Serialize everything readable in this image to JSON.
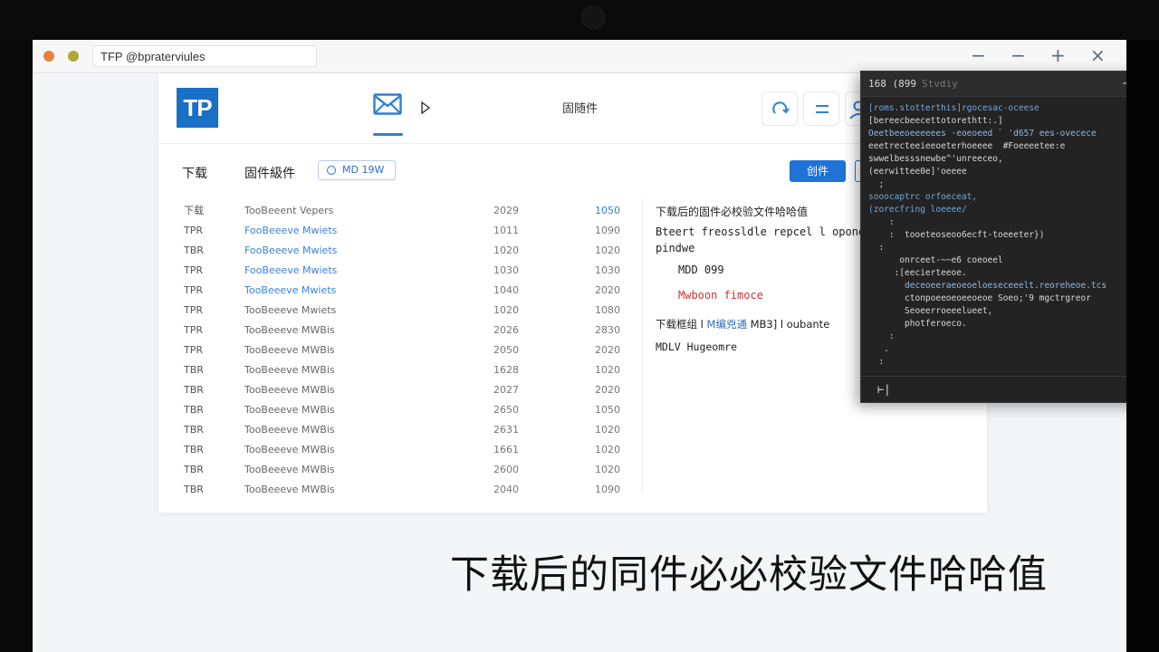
{
  "window": {
    "tab_title": "TFP @bpraterviules",
    "controls": [
      "minimize-icon",
      "minimize-icon",
      "maximize-icon",
      "close-icon"
    ]
  },
  "app": {
    "logo_text": "TP",
    "nav_title": "固随件",
    "toolbar": {
      "tab_download": "下载",
      "tab_firmware": "固件級件",
      "search_value": "MD 19W",
      "primary_button": "创件"
    },
    "table": {
      "rows": [
        {
          "c1": "下载",
          "c2": "TooBeeent Vepers",
          "c3": "2029",
          "c4": "1050"
        },
        {
          "c1": "TPR",
          "c2": "FooBeeeve Mwiets",
          "c3": "1011",
          "c4": "1090"
        },
        {
          "c1": "TBR",
          "c2": "FooBeeeve Mwiets",
          "c3": "1020",
          "c4": "1020"
        },
        {
          "c1": "TPR",
          "c2": "FooBeeeve Mwiets",
          "c3": "1030",
          "c4": "1030"
        },
        {
          "c1": "TPR",
          "c2": "TooBeeeve Mwiets",
          "c3": "1040",
          "c4": "2020"
        },
        {
          "c1": "TPR",
          "c2": "TooBeeeve Mwiets",
          "c3": "1020",
          "c4": "1080"
        },
        {
          "c1": "TPR",
          "c2": "TooBeeeve MWBis",
          "c3": "2026",
          "c4": "2830"
        },
        {
          "c1": "TPR",
          "c2": "TooBeeeve MWBis",
          "c3": "2050",
          "c4": "2020"
        },
        {
          "c1": "TBR",
          "c2": "TooBeeeve MWBis",
          "c3": "1628",
          "c4": "1020"
        },
        {
          "c1": "TBR",
          "c2": "TooBeeeve MWBis",
          "c3": "2027",
          "c4": "2020"
        },
        {
          "c1": "TBR",
          "c2": "TooBeeeve MWBis",
          "c3": "2650",
          "c4": "1050"
        },
        {
          "c1": "TBR",
          "c2": "TooBeeeve MWBis",
          "c3": "2631",
          "c4": "1020"
        },
        {
          "c1": "TBR",
          "c2": "TooBeeeve MWBis",
          "c3": "1661",
          "c4": "1020"
        },
        {
          "c1": "TBR",
          "c2": "TooBeeeve MWBis",
          "c3": "2600",
          "c4": "1020"
        },
        {
          "c1": "TBR",
          "c2": "TooBeeeve MWBis",
          "c3": "2040",
          "c4": "1090"
        }
      ]
    },
    "detail": {
      "title": "下载后的固件必校验文件哈哈值",
      "line1": "Bteert freossldle repcel l opone",
      "line2": "pindwe",
      "mdd": "MDD 099",
      "red_text": "Mwboon fimoce",
      "download_label": "下载框组 l",
      "download_link": "M编兇通",
      "download_mid": "MB3] l",
      "download_tail": "oubante",
      "mdlv": "MDLV Hugeomre"
    }
  },
  "terminal": {
    "title": "168 (899",
    "title_dim": "Stvdiy",
    "lines": [
      "[roms.stotterthis]rgocesac-oceese",
      "[bereecbeecettotorethtt:.]",
      "Oeetbeeoeeeeees ·eoeoeed ` 'd657 ees-ovecece",
      "eeetrecteeieeoeterhoeeee  #Foeeeetee:e",
      "swwelbesssnewbe^'unreeceo,",
      "(eerwittee0e]'oeeee",
      "  ;",
      "sooocaptrc orfoeceat,",
      "(zorecfring loeeee/",
      "    :",
      "    :  tooeteoseoo6ecft-toeeeter})",
      "  :",
      "      onrceet-~~e6 coeoeel",
      "     :[eecierteeoe.",
      "       deceoeeraeoeoeloeseceeelt.reoreheoe.tcs",
      "       ctonpoeeoeoeeoeoe Soeo;'9 mgctrgreor",
      "       Seoeerroeeelueet,",
      "       photferoeco.",
      "    :",
      "   .",
      "  :"
    ],
    "prompt": "⊢|"
  },
  "caption": "下载后的同件必必校验文件哈哈值",
  "colors": {
    "accent": "#1f72d6",
    "terminal_bg": "#232323",
    "error_red": "#cf3232"
  }
}
